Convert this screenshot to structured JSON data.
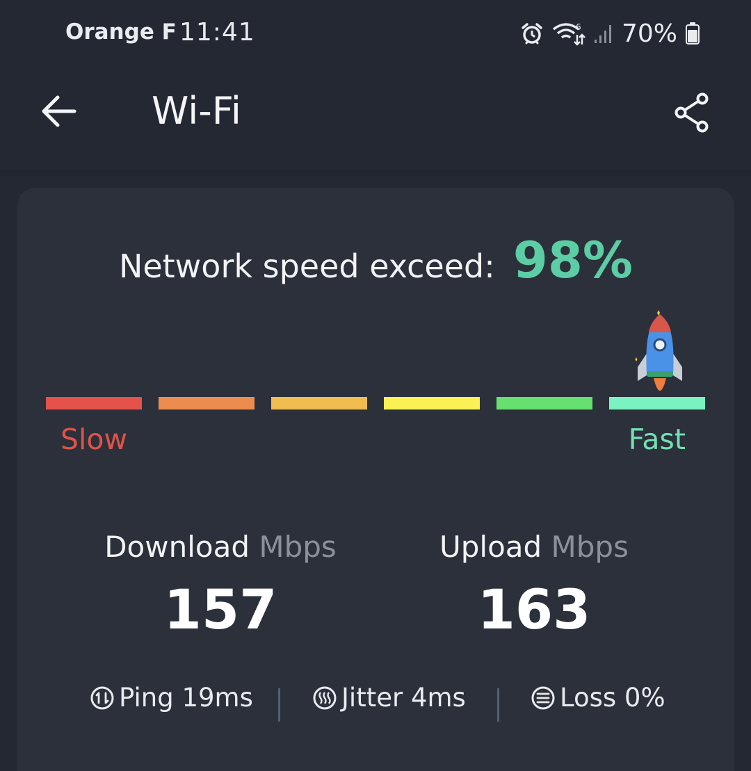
{
  "status_bar": {
    "carrier": "Orange F",
    "time": "11:41",
    "battery": "70%",
    "icons": [
      "alarm-icon",
      "wifi-6-icon",
      "signal-bars-icon",
      "battery-icon"
    ]
  },
  "app_bar": {
    "title": "Wi-Fi",
    "back_icon": "arrow-left-icon",
    "share_icon": "share-icon"
  },
  "result": {
    "headline_label": "Network speed exceed:",
    "headline_value": "98%",
    "speed_level": 0.98,
    "slow_label": "Slow",
    "fast_label": "Fast",
    "segment_colors": [
      "#e5514b",
      "#ec8d4f",
      "#f1bc50",
      "#fbf155",
      "#66e06f",
      "#7af2c1"
    ]
  },
  "download": {
    "label": "Download",
    "unit": "Mbps",
    "value": "157"
  },
  "upload": {
    "label": "Upload",
    "unit": "Mbps",
    "value": "163"
  },
  "stats": {
    "ping": "Ping 19ms",
    "jitter": "Jitter 4ms",
    "loss": "Loss 0%"
  }
}
